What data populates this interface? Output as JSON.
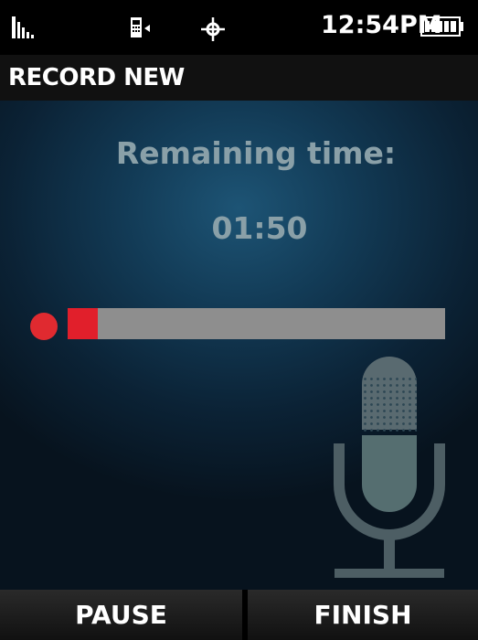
{
  "status_bar": {
    "time": "12:54PM",
    "icons": [
      "signal-icon",
      "phone-icon",
      "gps-icon",
      "battery-icon"
    ]
  },
  "header": {
    "title": "RECORD NEW"
  },
  "recorder": {
    "remaining_label": "Remaining time:",
    "remaining_time": "01:50",
    "progress_fraction": 0.08,
    "accent_color": "#e11f2b"
  },
  "softkeys": {
    "left_label": "PAUSE",
    "right_label": "FINISH"
  }
}
